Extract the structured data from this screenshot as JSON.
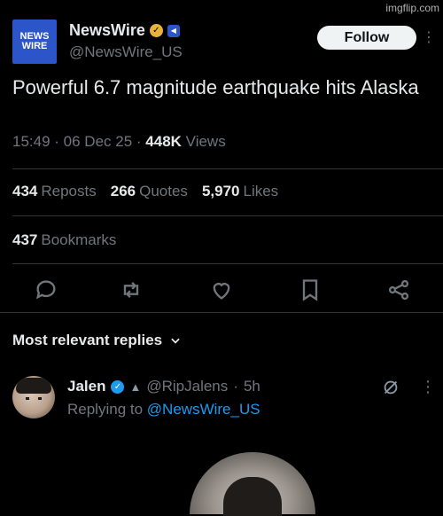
{
  "watermark": "imgflip.com",
  "account": {
    "logo_line1": "NEWS",
    "logo_line2": "WIRE",
    "display_name": "NewsWire",
    "handle": "@NewsWire_US",
    "follow_label": "Follow"
  },
  "tweet": {
    "text": "Powerful 6.7 magnitude earthquake hits Alaska",
    "time": "15:49",
    "date": "06 Dec 25",
    "views_count": "448K",
    "views_label": "Views"
  },
  "stats": {
    "reposts_count": "434",
    "reposts_label": "Reposts",
    "quotes_count": "266",
    "quotes_label": "Quotes",
    "likes_count": "5,970",
    "likes_label": "Likes",
    "bookmarks_count": "437",
    "bookmarks_label": "Bookmarks"
  },
  "actions": [
    "reply-icon",
    "repost-icon",
    "like-icon",
    "bookmark-icon",
    "share-icon"
  ],
  "replies": {
    "header": "Most relevant replies",
    "items": [
      {
        "name": "Jalen",
        "handle": "@RipJalens",
        "time": "5h",
        "replying_prefix": "Replying to",
        "replying_to": "@NewsWire_US"
      }
    ]
  },
  "colors": {
    "background": "#000000",
    "text": "#e7e9ea",
    "muted": "#71767b",
    "accent": "#1d9bf0",
    "gold_check": "#e8b33a",
    "logo_blue": "#2b55c9"
  }
}
